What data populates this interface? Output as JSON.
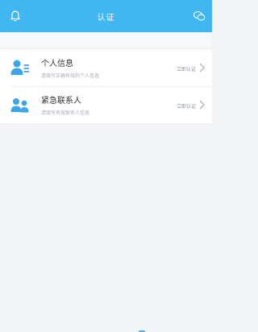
{
  "header": {
    "title": "认证",
    "left_icon": "bell-icon",
    "right_icon": "chat-icon",
    "background": "#41b6f0"
  },
  "items": [
    {
      "title": "个人信息",
      "subtitle": "请填写正确有效的个人信息",
      "action": "立即认证",
      "icon": "person-id-icon"
    },
    {
      "title": "紧急联系人",
      "subtitle": "请填写有效联系人信息",
      "action": "立即认证",
      "icon": "contacts-icon"
    }
  ]
}
